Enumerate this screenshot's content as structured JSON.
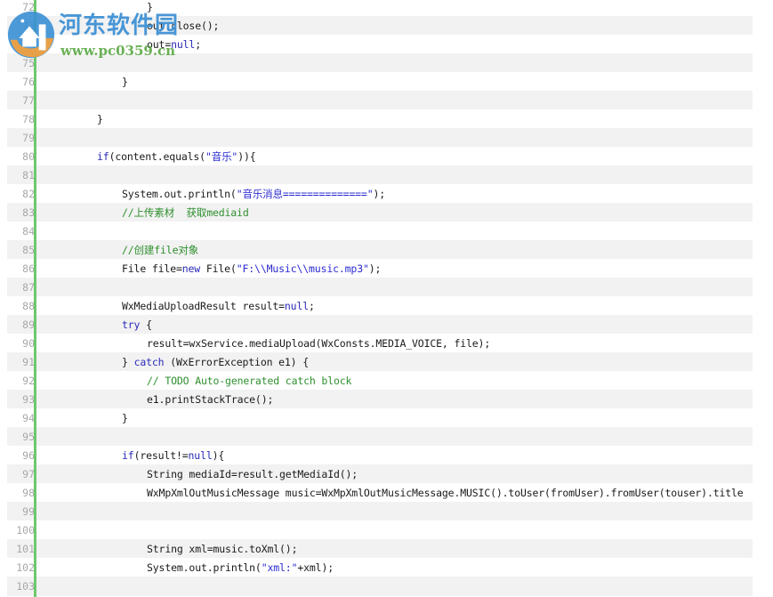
{
  "watermark": {
    "title": "河东软件园",
    "url": "www.pc0359.cn",
    "colors": {
      "title": "#3a8fd4",
      "url": "#5aa843",
      "logo_blue": "#3a8fd4",
      "logo_orange": "#f0a040"
    }
  },
  "editor": {
    "gutter_color": "#6cc96c",
    "alt_row_color": "#f2f2f2",
    "lines": [
      {
        "n": "72",
        "indent": 4,
        "tokens": [
          {
            "t": "}",
            "c": "p"
          }
        ]
      },
      {
        "n": "73",
        "indent": 4,
        "tokens": [
          {
            "t": "out.close();",
            "c": "p"
          }
        ]
      },
      {
        "n": "74",
        "indent": 4,
        "tokens": [
          {
            "t": "out=",
            "c": "p"
          },
          {
            "t": "null",
            "c": "kw"
          },
          {
            "t": ";",
            "c": "p"
          }
        ]
      },
      {
        "n": "75",
        "indent": 0,
        "tokens": []
      },
      {
        "n": "76",
        "indent": 3,
        "tokens": [
          {
            "t": "}",
            "c": "p"
          }
        ]
      },
      {
        "n": "77",
        "indent": 0,
        "tokens": []
      },
      {
        "n": "78",
        "indent": 2,
        "tokens": [
          {
            "t": "}",
            "c": "p"
          }
        ]
      },
      {
        "n": "79",
        "indent": 0,
        "tokens": []
      },
      {
        "n": "80",
        "indent": 2,
        "tokens": [
          {
            "t": "if",
            "c": "kw"
          },
          {
            "t": "(content.equals(",
            "c": "p"
          },
          {
            "t": "\"音乐\"",
            "c": "str"
          },
          {
            "t": ")){",
            "c": "p"
          }
        ]
      },
      {
        "n": "81",
        "indent": 0,
        "tokens": []
      },
      {
        "n": "82",
        "indent": 3,
        "tokens": [
          {
            "t": "System.out.println(",
            "c": "p"
          },
          {
            "t": "\"音乐消息==============\"",
            "c": "str"
          },
          {
            "t": ");",
            "c": "p"
          }
        ]
      },
      {
        "n": "83",
        "indent": 3,
        "tokens": [
          {
            "t": "//上传素材  获取mediaid",
            "c": "cm"
          }
        ]
      },
      {
        "n": "84",
        "indent": 0,
        "tokens": []
      },
      {
        "n": "85",
        "indent": 3,
        "tokens": [
          {
            "t": "//创建file对象",
            "c": "cm"
          }
        ]
      },
      {
        "n": "86",
        "indent": 3,
        "tokens": [
          {
            "t": "File file=",
            "c": "p"
          },
          {
            "t": "new",
            "c": "kw"
          },
          {
            "t": " File(",
            "c": "p"
          },
          {
            "t": "\"F:\\\\Music\\\\music.mp3\"",
            "c": "str"
          },
          {
            "t": ");",
            "c": "p"
          }
        ]
      },
      {
        "n": "87",
        "indent": 0,
        "tokens": []
      },
      {
        "n": "88",
        "indent": 3,
        "tokens": [
          {
            "t": "WxMediaUploadResult result=",
            "c": "p"
          },
          {
            "t": "null",
            "c": "kw"
          },
          {
            "t": ";",
            "c": "p"
          }
        ]
      },
      {
        "n": "89",
        "indent": 3,
        "tokens": [
          {
            "t": "try",
            "c": "kw"
          },
          {
            "t": " {",
            "c": "p"
          }
        ]
      },
      {
        "n": "90",
        "indent": 4,
        "tokens": [
          {
            "t": "result=wxService.mediaUpload(WxConsts.MEDIA_VOICE, file);",
            "c": "p"
          }
        ]
      },
      {
        "n": "91",
        "indent": 3,
        "tokens": [
          {
            "t": "} ",
            "c": "p"
          },
          {
            "t": "catch",
            "c": "kw"
          },
          {
            "t": " (WxErrorException e1) {",
            "c": "p"
          }
        ]
      },
      {
        "n": "92",
        "indent": 4,
        "tokens": [
          {
            "t": "// TODO Auto-generated catch block",
            "c": "cm"
          }
        ]
      },
      {
        "n": "93",
        "indent": 4,
        "tokens": [
          {
            "t": "e1.printStackTrace();",
            "c": "p"
          }
        ]
      },
      {
        "n": "94",
        "indent": 3,
        "tokens": [
          {
            "t": "}",
            "c": "p"
          }
        ]
      },
      {
        "n": "95",
        "indent": 0,
        "tokens": []
      },
      {
        "n": "96",
        "indent": 3,
        "tokens": [
          {
            "t": "if",
            "c": "kw"
          },
          {
            "t": "(result!=",
            "c": "p"
          },
          {
            "t": "null",
            "c": "kw"
          },
          {
            "t": "){",
            "c": "p"
          }
        ]
      },
      {
        "n": "97",
        "indent": 4,
        "tokens": [
          {
            "t": "String mediaId=result.getMediaId();",
            "c": "p"
          }
        ]
      },
      {
        "n": "98",
        "indent": 4,
        "tokens": [
          {
            "t": "WxMpXmlOutMusicMessage music=WxMpXmlOutMusicMessage.MUSIC().toUser(fromUser).fromUser(touser).title",
            "c": "p"
          }
        ]
      },
      {
        "n": "99",
        "indent": 0,
        "tokens": []
      },
      {
        "n": "100",
        "indent": 0,
        "tokens": []
      },
      {
        "n": "101",
        "indent": 4,
        "tokens": [
          {
            "t": "String xml=music.toXml();",
            "c": "p"
          }
        ]
      },
      {
        "n": "102",
        "indent": 4,
        "tokens": [
          {
            "t": "System.out.println(",
            "c": "p"
          },
          {
            "t": "\"xml:\"",
            "c": "str"
          },
          {
            "t": "+xml);",
            "c": "p"
          }
        ]
      },
      {
        "n": "103",
        "indent": 0,
        "tokens": []
      }
    ]
  }
}
